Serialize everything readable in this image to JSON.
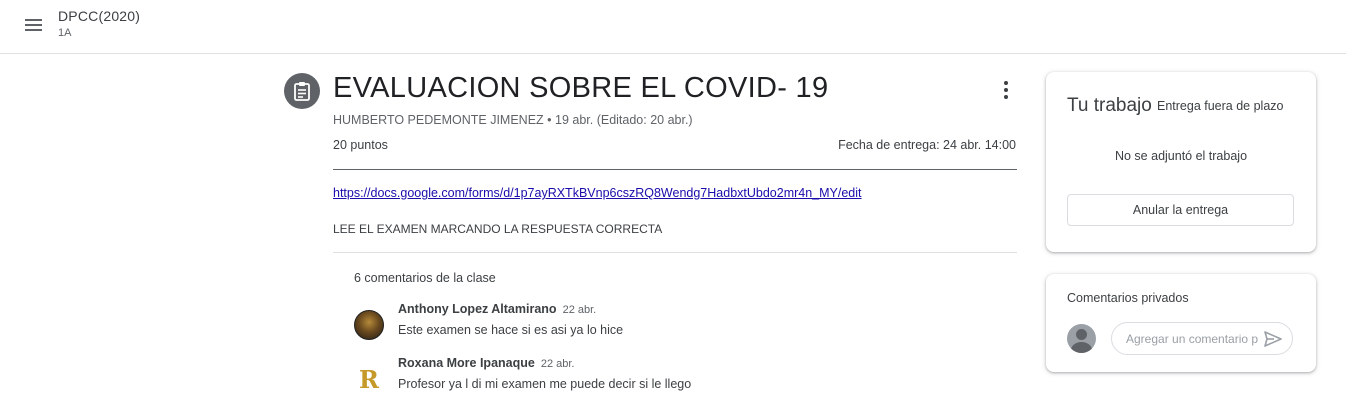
{
  "header": {
    "class_name": "DPCC(2020)",
    "section": "1A"
  },
  "assignment": {
    "title": "EVALUACION SOBRE EL COVID- 19",
    "meta": "HUMBERTO PEDEMONTE JIMENEZ • 19 abr. (Editado: 20 abr.)",
    "points": "20 puntos",
    "due": "Fecha de entrega: 24 abr. 14:00",
    "link": "https://docs.google.com/forms/d/1p7ayRXTkBVnp6cszRQ8Wendg7HadbxtUbdo2mr4n_MY/edit",
    "description": "LEE EL EXAMEN MARCANDO LA RESPUESTA CORRECTA"
  },
  "class_comments": {
    "header": "6 comentarios de la clase",
    "items": [
      {
        "author": "Anthony Lopez Altamirano",
        "date": "22 abr.",
        "text": "Este examen se hace si es asi ya lo hice"
      },
      {
        "author": "Roxana More Ipanaque",
        "date": "22 abr.",
        "text": "Profesor ya l di mi examen me puede decir si le llego",
        "avatar_letter": "R"
      }
    ]
  },
  "your_work": {
    "title": "Tu trabajo",
    "status": "Entrega fuera de plazo",
    "no_attachment": "No se adjuntó el trabajo",
    "unsubmit_label": "Anular la entrega"
  },
  "private_comments": {
    "title": "Comentarios privados",
    "placeholder": "Agregar un comentario privado..."
  },
  "icons": {
    "menu": "menu-icon",
    "assignment": "assignment-icon",
    "more": "more-vert-icon",
    "send": "send-icon",
    "user": "account-circle-icon"
  },
  "colors": {
    "link": "#1a0dab",
    "icon_bg": "#5f6368"
  }
}
